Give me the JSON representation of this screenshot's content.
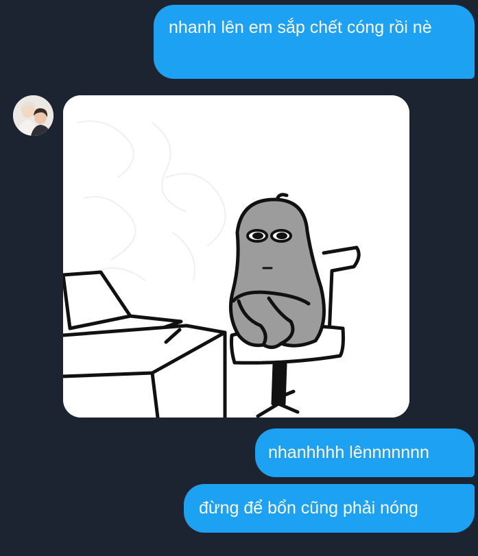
{
  "conversation": {
    "messages": [
      {
        "sender": "me",
        "text": "nhanh lên em sắp chết cóng rồi nè"
      },
      {
        "sender": "other",
        "type": "image",
        "image": "meme-character-sitting-on-chair-icon"
      },
      {
        "sender": "me",
        "text": "nhanhhhh lênnnnnnn"
      },
      {
        "sender": "me",
        "text": "đừng để bổn cũng phải nóng"
      }
    ],
    "avatar": "contact-avatar-photo"
  },
  "colors": {
    "background": "#1b2430",
    "outgoing_bubble": "#1da1f2",
    "bubble_text": "#ffffff"
  }
}
